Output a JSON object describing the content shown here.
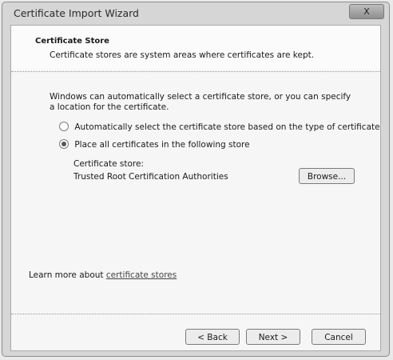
{
  "window": {
    "title": "Certificate Import Wizard",
    "close_label": "X"
  },
  "header": {
    "title": "Certificate Store",
    "description": "Certificate stores are system areas where certificates are kept."
  },
  "body": {
    "intro": "Windows can automatically select a certificate store, or you can specify a location for the certificate.",
    "options": [
      {
        "label": "Automatically select the certificate store based on the type of certificate",
        "selected": false
      },
      {
        "label": "Place all certificates in the following store",
        "selected": true
      }
    ],
    "store_label": "Certificate store:",
    "store_value": "Trusted Root Certification Authorities",
    "browse_label": "Browse..."
  },
  "footer": {
    "learn_prefix": "Learn more about",
    "learn_link": "certificate stores",
    "back_label": "< Back",
    "next_label": "Next >",
    "cancel_label": "Cancel"
  }
}
